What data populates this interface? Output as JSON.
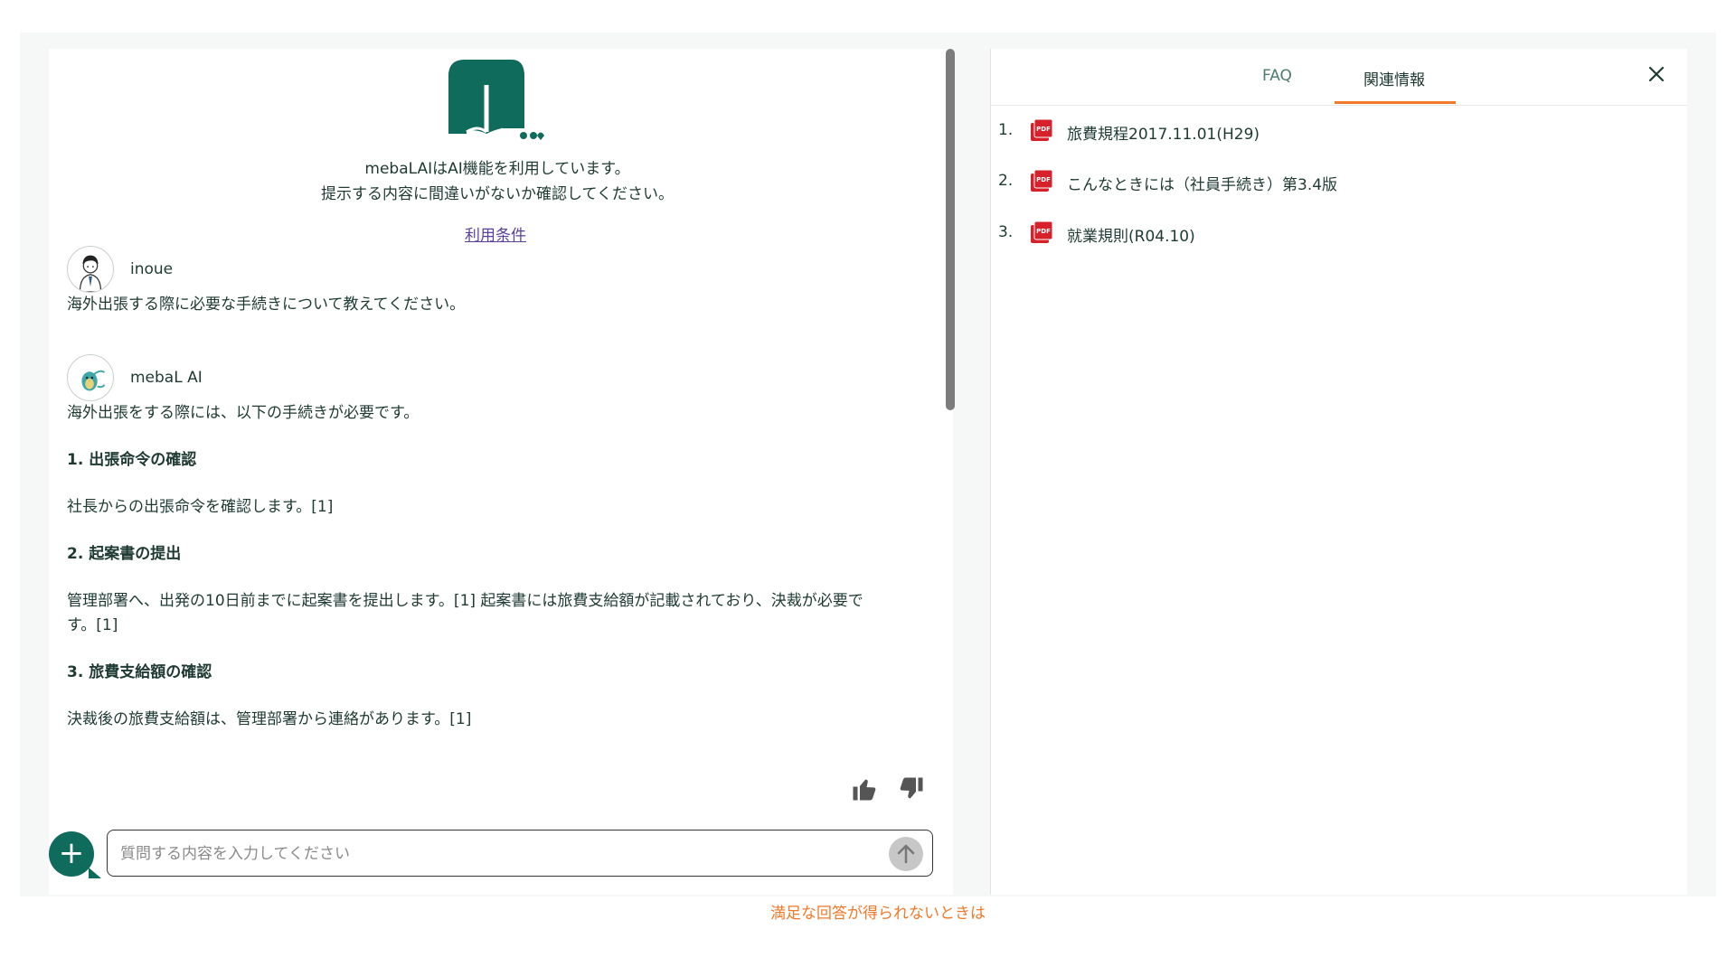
{
  "chat": {
    "disclaimer_line1": "mebaLAIはAI機能を利用しています。",
    "disclaimer_line2": "提示する内容に間違いがないか確認してください。",
    "terms_link": "利用条件",
    "user": {
      "name": "inoue",
      "message": "海外出張する際に必要な手続きについて教えてください。"
    },
    "ai": {
      "name": "mebaL AI",
      "intro": "海外出張をする際には、以下の手続きが必要です。",
      "steps": [
        {
          "heading": "1. 出張命令の確認",
          "body": "社長からの出張命令を確認します。[1]"
        },
        {
          "heading": "2. 起案書の提出",
          "body": "管理部署へ、出発の10日前までに起案書を提出します。[1] 起案書には旅費支給額が記載されており、決裁が必要で",
          "body_cont": "す。[1]"
        },
        {
          "heading": "3. 旅費支給額の確認",
          "body": "決裁後の旅費支給額は、管理部署から連絡があります。[1]"
        }
      ]
    },
    "input": {
      "placeholder": "質問する内容を入力してください",
      "value": ""
    },
    "help_link": "満足な回答が得られないときは"
  },
  "side_panel": {
    "tabs": [
      {
        "label": "FAQ",
        "active": false
      },
      {
        "label": "関連情報",
        "active": true
      }
    ],
    "documents": [
      {
        "num": "1.",
        "title": "旅費規程2017.11.01(H29)",
        "icon": "pdf-icon"
      },
      {
        "num": "2.",
        "title": "こんなときには（社員手続き）第3.4版",
        "icon": "pdf-icon"
      },
      {
        "num": "3.",
        "title": "就業規則(R04.10)",
        "icon": "pdf-icon"
      }
    ]
  },
  "colors": {
    "brand_green": "#0f6b5c",
    "accent_orange": "#f07a2a",
    "pdf_red": "#d6212a"
  }
}
